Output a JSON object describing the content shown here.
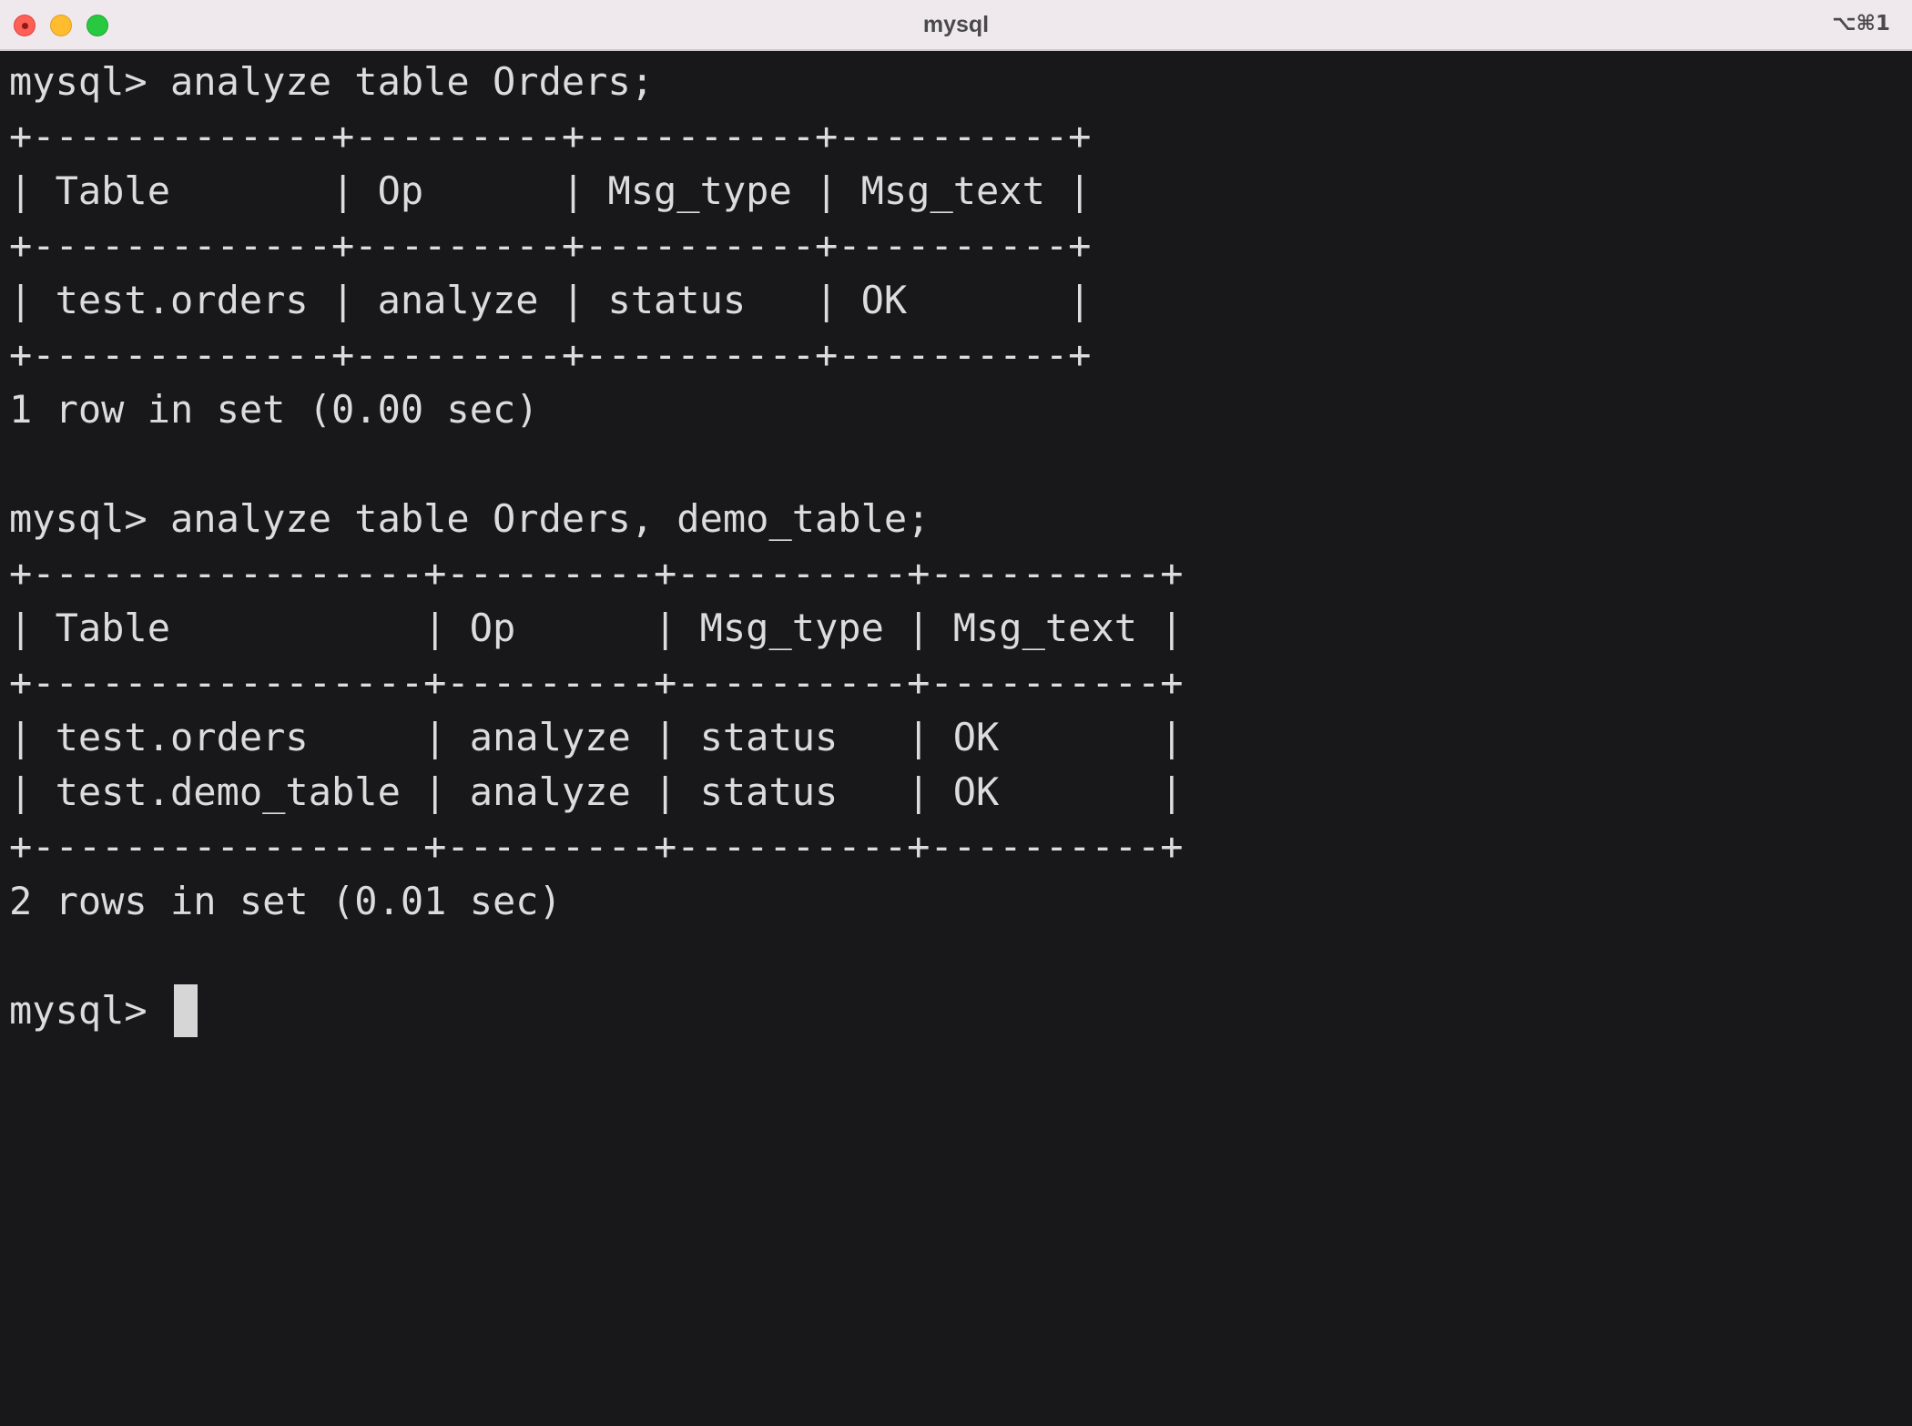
{
  "window": {
    "title": "mysql",
    "shortcut": "⌥⌘1"
  },
  "terminal": {
    "lines": [
      "mysql> analyze table Orders;",
      "+-------------+---------+----------+----------+",
      "| Table       | Op      | Msg_type | Msg_text |",
      "+-------------+---------+----------+----------+",
      "| test.orders | analyze | status   | OK       |",
      "+-------------+---------+----------+----------+",
      "1 row in set (0.00 sec)",
      "",
      "mysql> analyze table Orders, demo_table;",
      "+-----------------+---------+----------+----------+",
      "| Table           | Op      | Msg_type | Msg_text |",
      "+-----------------+---------+----------+----------+",
      "| test.orders     | analyze | status   | OK       |",
      "| test.demo_table | analyze | status   | OK       |",
      "+-----------------+---------+----------+----------+",
      "2 rows in set (0.01 sec)",
      ""
    ],
    "prompt": "mysql> "
  },
  "colors": {
    "background": "#18181a",
    "foreground": "#dcdcdc",
    "titlebar": "#efe9ee"
  }
}
